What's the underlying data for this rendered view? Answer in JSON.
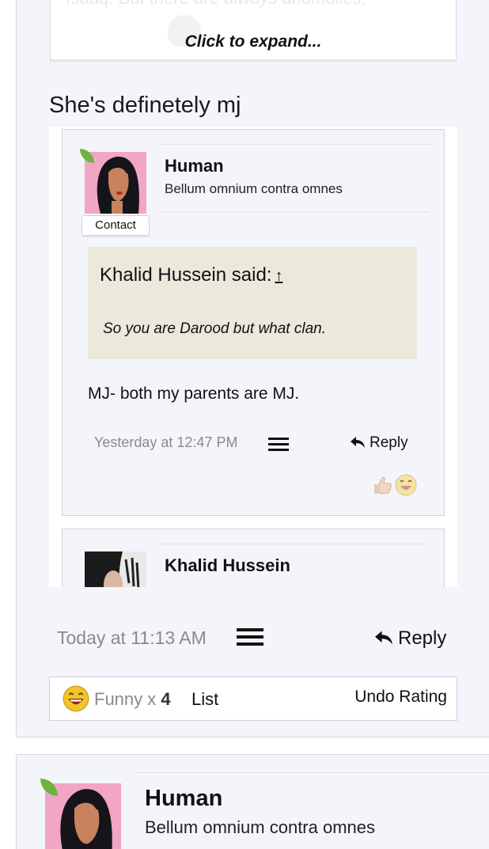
{
  "quote_box": {
    "faded_text": "Isaaq. But there are always anomolies,",
    "expand_label": "Click to expand..."
  },
  "post": {
    "text": "She's definetely mj",
    "timestamp": "Today at 11:13 AM",
    "reply_label": "Reply"
  },
  "embedded_posts": [
    {
      "username": "Human",
      "user_title": "Bellum omnium contra omnes",
      "contact_label": "Contact",
      "quote": {
        "attribution": "Khalid Hussein said:",
        "up_arrow": "↑",
        "text": "So you are Darood but what clan."
      },
      "body": "MJ- both my parents are MJ.",
      "timestamp": "Yesterday at 12:47 PM",
      "reply_label": "Reply",
      "reactions": [
        "like-icon",
        "funny-icon"
      ]
    },
    {
      "username": "Khalid Hussein"
    }
  ],
  "rating_summary": {
    "icon": "funny-icon",
    "label": "Funny",
    "multiplier": "x",
    "count": "4",
    "list_label": "List",
    "undo_label": "Undo Rating"
  },
  "next_post": {
    "username": "Human",
    "user_title": "Bellum omnium contra omnes"
  },
  "colors": {
    "panel_bg": "#f4f5fa",
    "quote_bg": "#ebe8dc",
    "online_indicator": "#6db33f",
    "muted_text": "#8a8a8a"
  }
}
